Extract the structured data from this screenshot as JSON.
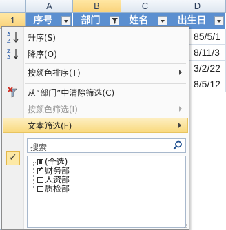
{
  "sheet": {
    "columns": [
      "A",
      "B",
      "C",
      "D"
    ],
    "row_numbers": [
      "1"
    ],
    "headers": [
      "序号",
      "部门",
      "姓名",
      "出生日"
    ],
    "dates": [
      "85/5/1",
      "8/11/3",
      "3/2/22",
      "8/5/12"
    ]
  },
  "menu": {
    "sort_asc": "升序(S)",
    "sort_desc": "降序(O)",
    "sort_by_color": "按颜色排序(T)",
    "clear_filter": "从“部门”中清除筛选(C)",
    "filter_by_color": "按颜色筛选(I)",
    "text_filter": "文本筛选(F)",
    "search_placeholder": "搜索",
    "list": {
      "select_all": "(全选)",
      "items": [
        "财务部",
        "人资部",
        "质检部"
      ]
    }
  },
  "colors": {
    "header_blue": "#5b8fd0",
    "highlight": "#f9d97e"
  }
}
